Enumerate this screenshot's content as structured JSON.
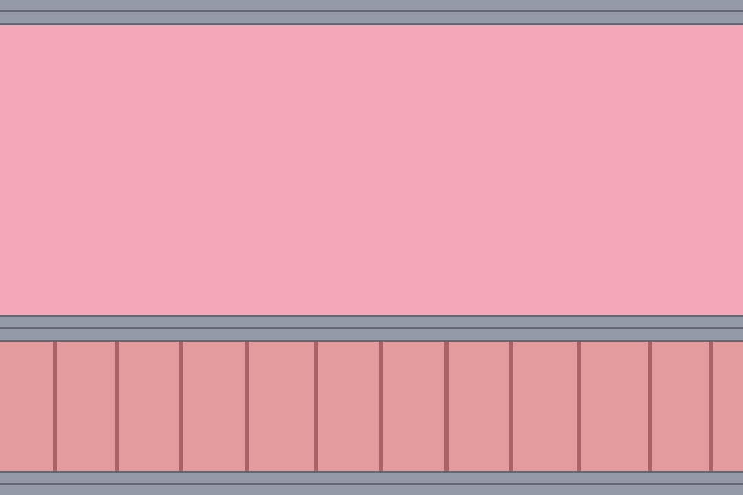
{
  "scene": {
    "colors": {
      "trim": "#949aa8",
      "trim_line": "#636774",
      "upper_wall": "#f4a7b7",
      "lower_panel": "#e39b9d",
      "panel_divider": "#aa6266"
    },
    "lower_panel_divider_count": 11
  }
}
